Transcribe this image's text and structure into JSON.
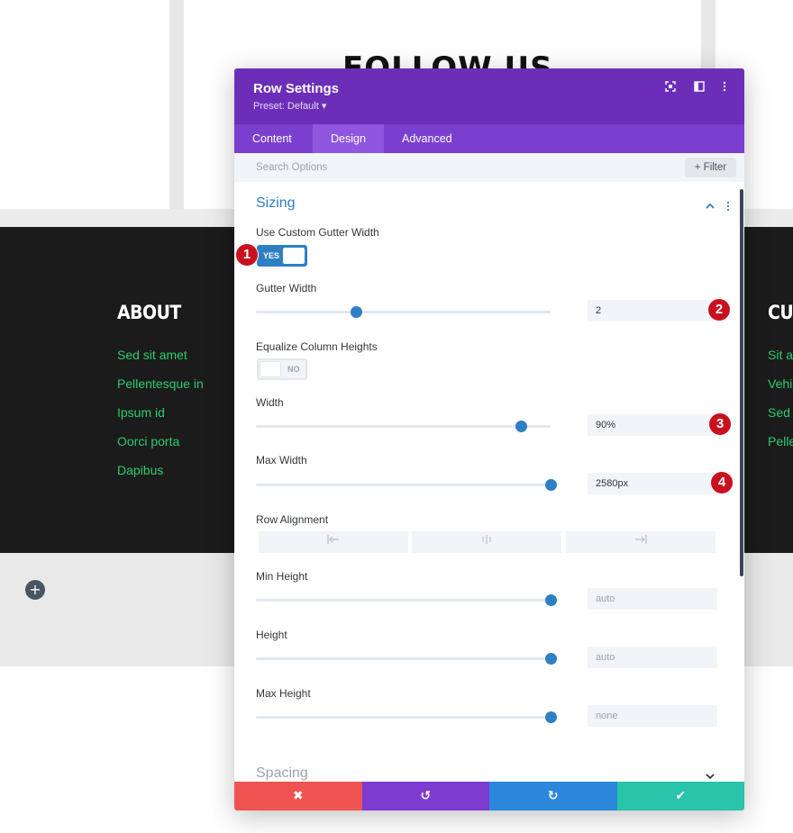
{
  "background": {
    "follow_title": "FOLLOW US",
    "about_heading": "ABOUT",
    "cus_heading": "CUS",
    "about_links": [
      "Sed sit amet",
      "Pellentesque in",
      "Ipsum id",
      "Oorci porta",
      "Dapibus"
    ],
    "right_links": [
      "Sit am",
      "Vehic",
      "Sed s",
      "Pelle"
    ],
    "add_symbol": "+"
  },
  "modal": {
    "title": "Row Settings",
    "preset": "Preset: Default ▾",
    "header_icons": [
      "expand-icon",
      "sidebar-icon",
      "more-icon"
    ],
    "tabs": [
      {
        "label": "Content",
        "active": false
      },
      {
        "label": "Design",
        "active": true
      },
      {
        "label": "Advanced",
        "active": false
      }
    ],
    "search_placeholder": "Search Options",
    "filter_label": "+ Filter"
  },
  "sizing": {
    "title": "Sizing",
    "custom_gutter": {
      "label": "Use Custom Gutter Width",
      "state": "YES",
      "on": true
    },
    "gutter_width": {
      "label": "Gutter Width",
      "value": "2",
      "slider_fraction": 0.34
    },
    "equalize": {
      "label": "Equalize Column Heights",
      "state": "NO",
      "on": false
    },
    "width": {
      "label": "Width",
      "value": "90%",
      "slider_fraction": 0.9
    },
    "max_width": {
      "label": "Max Width",
      "value": "2580px",
      "slider_fraction": 1.0
    },
    "row_alignment": {
      "label": "Row Alignment",
      "options": [
        "left",
        "center",
        "right"
      ]
    },
    "min_height": {
      "label": "Min Height",
      "value": "auto",
      "slider_fraction": 1.0
    },
    "height": {
      "label": "Height",
      "value": "auto",
      "slider_fraction": 1.0
    },
    "max_height": {
      "label": "Max Height",
      "value": "none",
      "slider_fraction": 1.0
    }
  },
  "spacing": {
    "title": "Spacing"
  },
  "badges": [
    "1",
    "2",
    "3",
    "4"
  ],
  "footer_buttons": {
    "cancel": "✖",
    "undo": "↺",
    "redo": "↻",
    "save": "✔"
  },
  "colors": {
    "purple_header": "#6c2eb9",
    "purple_tabs": "#7b3fcf",
    "accent_blue": "#2e7fc4",
    "footer_green_links": "#2ecc71",
    "badge_red": "#c8101e",
    "cancel": "#ef5350",
    "undo": "#7e3bd0",
    "redo": "#2b87da",
    "save": "#29c4a9"
  }
}
